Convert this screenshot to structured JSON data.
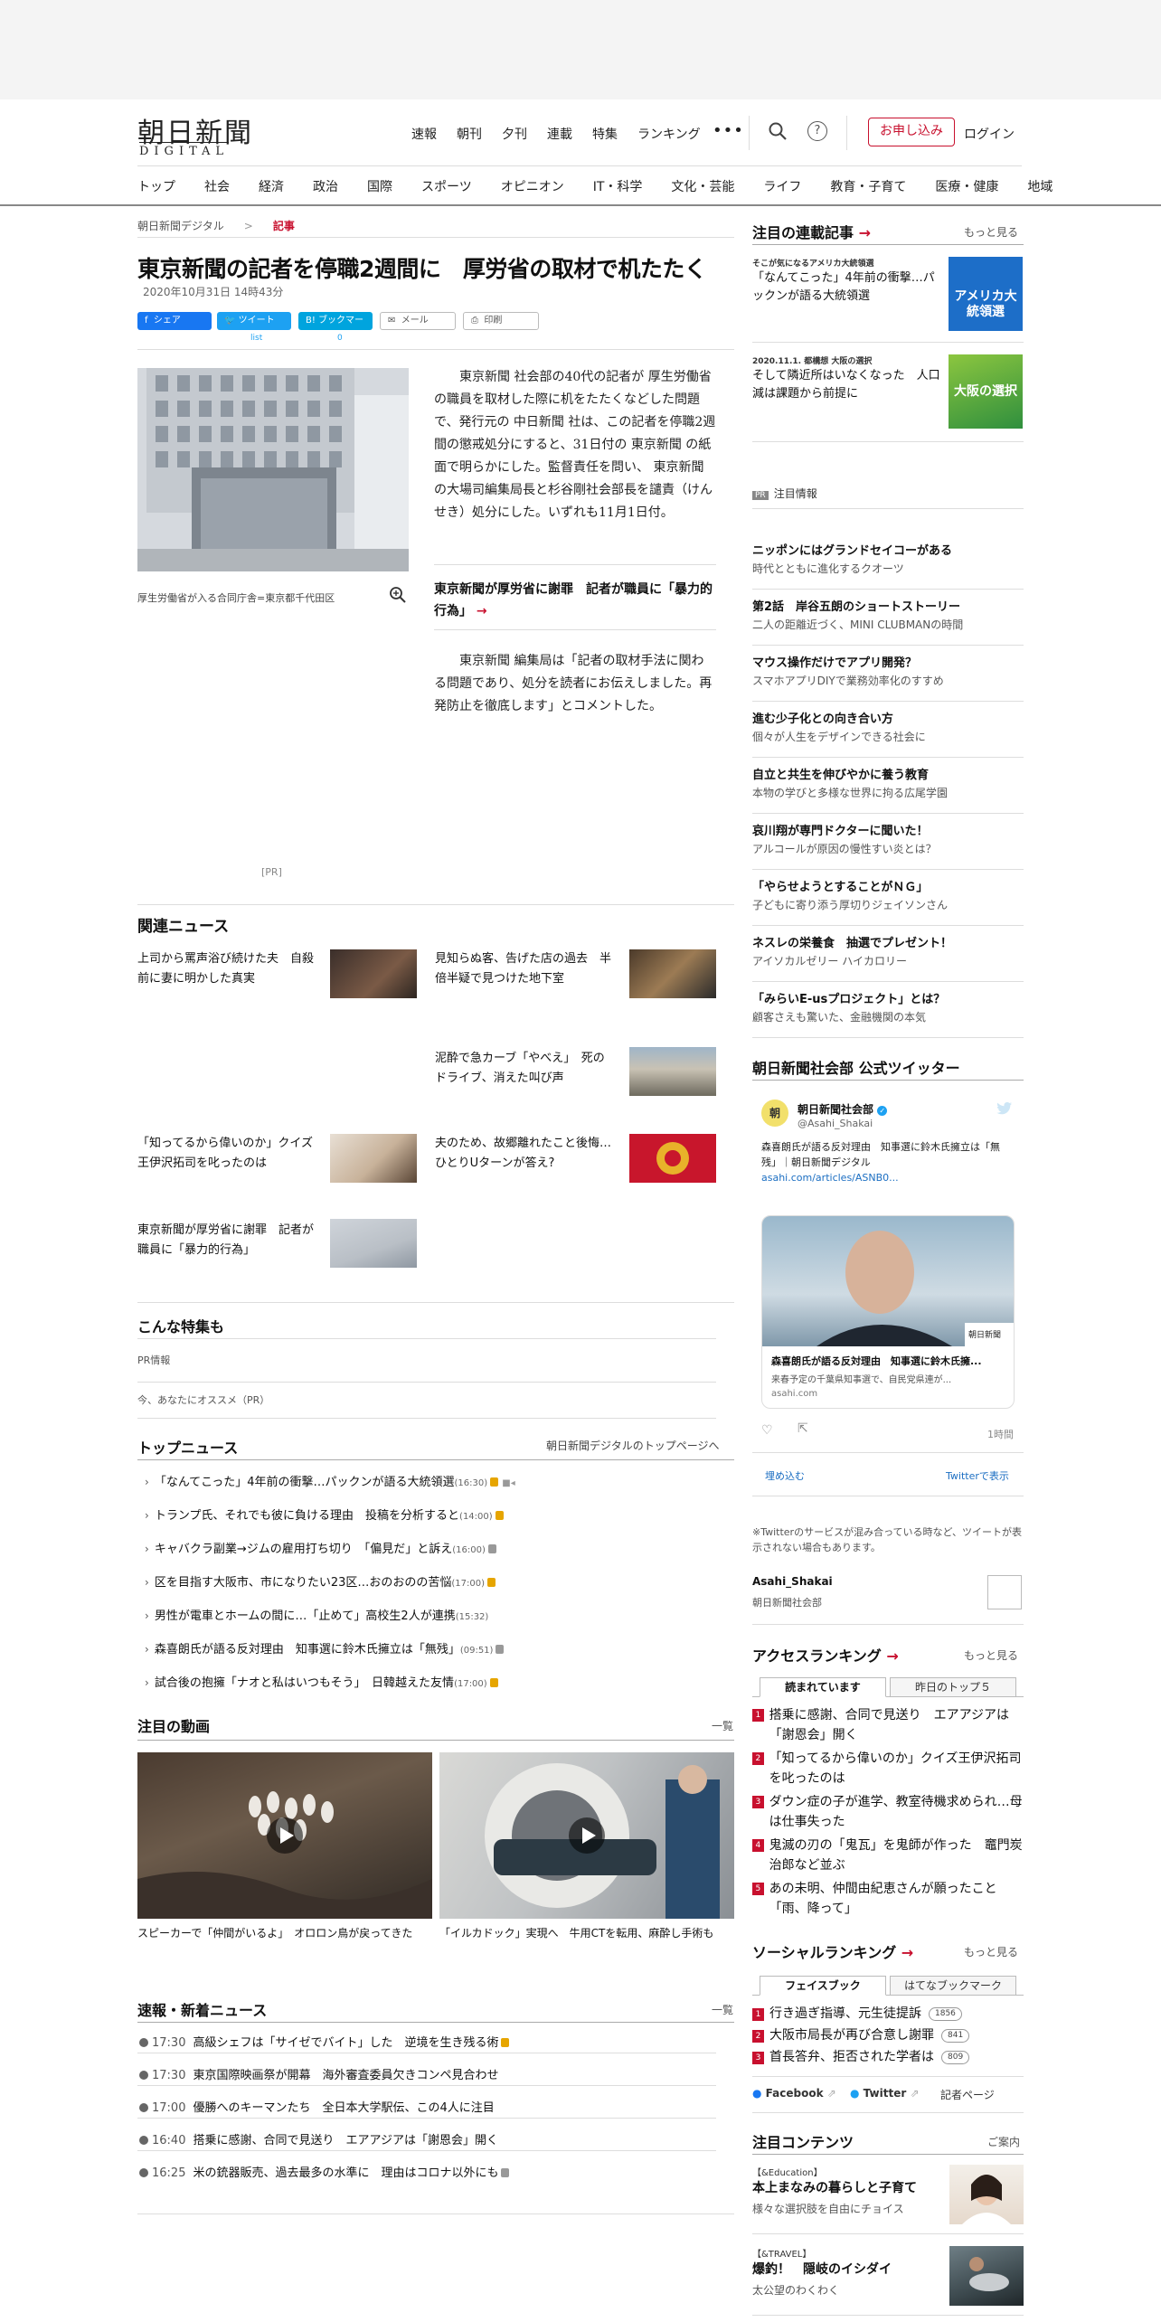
{
  "header": {
    "logo_main": "朝日新聞",
    "logo_sub": "DIGITAL",
    "nav": [
      "速報",
      "朝刊",
      "夕刊",
      "連載",
      "特集",
      "ランキング"
    ],
    "more": "•••",
    "subscribe": "お申し込み",
    "login": "ログイン"
  },
  "categories": [
    "トップ",
    "社会",
    "経済",
    "政治",
    "国際",
    "スポーツ",
    "オピニオン",
    "IT・科学",
    "文化・芸能",
    "ライフ",
    "教育・子育て",
    "医療・健康",
    "地域"
  ],
  "breadcrumb": {
    "home": "朝日新聞デジタル",
    "sep": ">",
    "current": "記事"
  },
  "article": {
    "title": "東京新聞の記者を停職2週間に　厚労省の取材で机たたく",
    "date": "2020年10月31日 14時43分",
    "share": {
      "facebook": "シェア",
      "tweet": "ツイート",
      "tweet_count": "list",
      "bookmark": "ブックマーク",
      "bookmark_count": "0",
      "mail": "メール",
      "print": "印刷"
    },
    "photo_caption": "厚生労働省が入る合同庁舎=東京都千代田区",
    "paragraph1": "東京新聞 社会部の40代の記者が 厚生労働省 の職員を取材した際に机をたたくなどした問題で、発行元の 中日新聞 社は、この記者を停職2週間の懲戒処分にすると、31日付の 東京新聞 の紙面で明らかにした。監督責任を問い、 東京新聞 の大場司編集局長と杉谷剛社会部長を譴責（けんせき）処分にした。いずれも11月1日付。",
    "inline_link": "東京新聞が厚労省に謝罪　記者が職員に「暴力的行為」",
    "paragraph2": "東京新聞 編集局は「記者の取材手法に関わる問題であり、処分を読者にお伝えしました。再発防止を徹底します」とコメントした。",
    "pr": "[PR]"
  },
  "related": {
    "heading": "関連ニュース",
    "items": [
      "上司から罵声浴び続けた夫　自殺前に妻に明かした真実",
      "見知らぬ客、告げた店の過去　半倍半疑で見つけた地下室",
      "泥酔で急カーブ「やべえ」　死のドライブ、消えた叫び声",
      "「知ってるから偉いのか」クイズ王伊沢拓司を叱ったのは",
      "夫のため、故郷離れたこと後悔…ひとりUターンが答え?",
      "東京新聞が厚労省に謝罪　記者が職員に「暴力的行為」"
    ]
  },
  "features": {
    "heading": "こんな特集も",
    "pr_info": "PR情報",
    "recommend": "今、あなたにオススメ（PR）"
  },
  "top_news": {
    "heading": "トップニュース",
    "link": "朝日新聞デジタルのトップページへ",
    "items": [
      {
        "text": "「なんてこった」4年前の衝撃…パックンが語る大統領選",
        "time": "(16:30)"
      },
      {
        "text": "トランプ氏、それでも彼に負ける理由　投稿を分析すると",
        "time": "(14:00)"
      },
      {
        "text": "キャバクラ副業→ジムの雇用打ち切り　「偏見だ」と訴え",
        "time": "(16:00)"
      },
      {
        "text": "区を目指す大阪市、市になりたい23区…おのおのの苦悩",
        "time": "(17:00)"
      },
      {
        "text": "男性が電車とホームの間に…「止めて」高校生2人が連携",
        "time": "(15:32)"
      },
      {
        "text": "森喜朗氏が語る反対理由　知事選に鈴木氏擁立は「無残」",
        "time": "(09:51)"
      },
      {
        "text": "試合後の抱擁「ナオと私はいつもそう」　日韓越えた友情",
        "time": "(17:00)"
      }
    ]
  },
  "videos": {
    "heading": "注目の動画",
    "more": "一覧",
    "items": [
      "スピーカーで「仲間がいるよ」　オロロン鳥が戻ってきた",
      "「イルカドック」実現へ　牛用CTを転用、麻酔し手術も"
    ]
  },
  "breaking": {
    "heading": "速報・新着ニュース",
    "more": "一覧",
    "items": [
      {
        "time": "17:30",
        "text": "高級シェフは「サイゼでバイト」した　逆境を生き残る術"
      },
      {
        "time": "17:30",
        "text": "東京国際映画祭が開幕　海外審査委員欠きコンペ見合わせ"
      },
      {
        "time": "17:00",
        "text": "優勝へのキーマンたち　全日本大学駅伝、この4人に注目"
      },
      {
        "time": "16:40",
        "text": "搭乗に感謝、合同で見送り　エアアジアは「謝恩会」開く"
      },
      {
        "time": "16:25",
        "text": "米の銃器販売、過去最多の水準に　理由はコロナ以外にも"
      }
    ]
  },
  "sidebar": {
    "series": {
      "heading": "注目の連載記事",
      "more": "もっと見る",
      "items": [
        {
          "kicker": "そこが気になるアメリカ大統領選",
          "title": "「なんてこった」4年前の衝撃…パックンが語る大統領選",
          "thumb": "アメリカ大統領選"
        },
        {
          "kicker": "2020.11.1. 都構想 大阪の選択",
          "title": "そして隣近所はいなくなった　人口減は課題から前提に",
          "thumb": "大阪の選択"
        }
      ]
    },
    "pr": {
      "label": "PR",
      "heading": "注目情報",
      "items": [
        {
          "title": "ニッポンにはグランドセイコーがある",
          "sub": "時代とともに進化するクオーツ"
        },
        {
          "title": "第2話　岸谷五朗のショートストーリー",
          "sub": "二人の距離近づく、MINI CLUBMANの時間"
        },
        {
          "title": "マウス操作だけでアプリ開発？",
          "sub": "スマホアプリDIYで業務効率化のすすめ"
        },
        {
          "title": "進む少子化との向き合い方",
          "sub": "個々が人生をデザインできる社会に"
        },
        {
          "title": "自立と共生を伸びやかに養う教育",
          "sub": "本物の学びと多様な世界に拘る広尾学園"
        },
        {
          "title": "哀川翔が専門ドクターに聞いた！",
          "sub": "アルコールが原因の慢性すい炎とは？"
        },
        {
          "title": "「やらせようとすることがＮＧ」",
          "sub": "子どもに寄り添う厚切りジェイソンさん"
        },
        {
          "title": "ネスレの栄養食　抽選でプレゼント！",
          "sub": "アイソカルゼリー ハイカロリー"
        },
        {
          "title": "「みらいE-usプロジェクト」とは？",
          "sub": "顧客さえも驚いた、金融機関の本気"
        }
      ]
    },
    "twitter": {
      "heading": "朝日新聞社会部 公式ツイッター",
      "account_name": "朝日新聞社会部",
      "handle": "@Asahi_Shakai",
      "avatar": "朝",
      "tweet_text": "森喜朗氏が語る反対理由　知事選に鈴木氏擁立は「無残」｜朝日新聞デジタル",
      "tweet_link": "asahi.com/articles/ASNB0...",
      "card_title": "森喜朗氏が語る反対理由　知事選に鈴木氏擁...",
      "card_desc": "来春予定の千葉県知事選で、自民党県連が...",
      "card_domain": "asahi.com",
      "card_watermark": "朝日新聞",
      "time": "1時間",
      "embed": "埋め込む",
      "view_on": "Twitterで表示",
      "note": "※Twitterのサービスが混み合っている時など、ツイートが表示されない場合もあります。",
      "profile_handle": "Asahi_Shakai",
      "profile_name": "朝日新聞社会部"
    },
    "access_ranking": {
      "heading": "アクセスランキング",
      "more": "もっと見る",
      "tabs": [
        "読まれています",
        "昨日のトップ５"
      ],
      "items": [
        "搭乗に感謝、合同で見送り　エアアジアは「謝恩会」開く",
        "「知ってるから偉いのか」クイズ王伊沢拓司を叱ったのは",
        "ダウン症の子が進学、教室待機求められ…母は仕事失った",
        "鬼滅の刃の「鬼瓦」を鬼師が作った　竈門炭治郎など並ぶ",
        "あの未明、仲間由紀恵さんが願ったこと　「雨、降って」"
      ]
    },
    "social_ranking": {
      "heading": "ソーシャルランキング",
      "more": "もっと見る",
      "tabs": [
        "フェイスブック",
        "はてなブックマーク"
      ],
      "items": [
        {
          "text": "行き過ぎ指導、元生徒提訴",
          "count": "1856"
        },
        {
          "text": "大阪市局長が再び合意し謝罪",
          "count": "841"
        },
        {
          "text": "首長答弁、拒否された学者は",
          "count": "809"
        }
      ],
      "links": [
        "Facebook",
        "Twitter",
        "記者ページ"
      ]
    },
    "contents": {
      "heading": "注目コンテンツ",
      "more": "ご案内",
      "items": [
        {
          "kicker": "【&Education】",
          "title": "本上まなみの暮らしと子育て",
          "sub": "様々な選択肢を自由にチョイス"
        },
        {
          "kicker": "【&TRAVEL】",
          "title": "爆釣！　隠岐のイシダイ",
          "sub": "太公望のわくわく"
        }
      ]
    }
  }
}
